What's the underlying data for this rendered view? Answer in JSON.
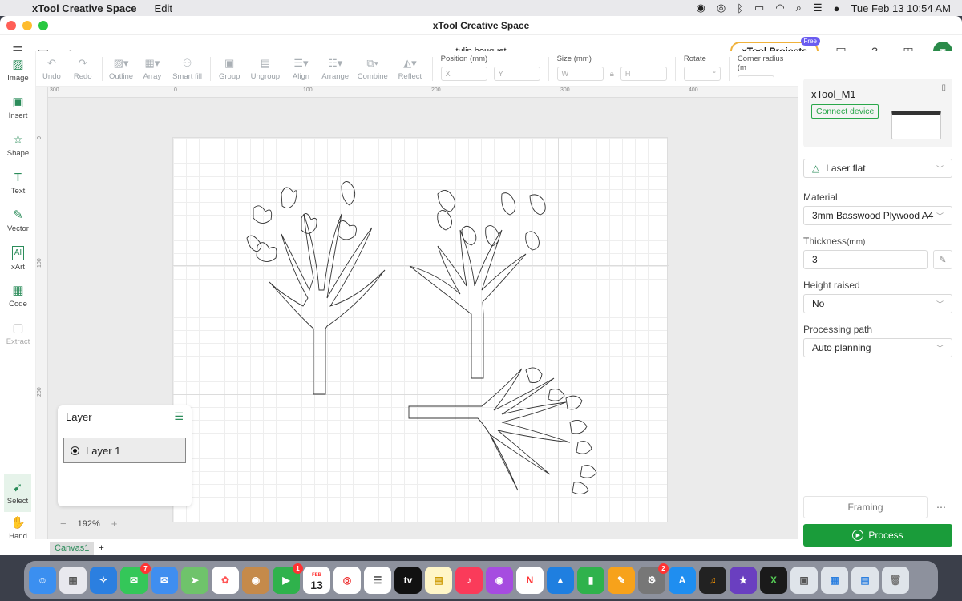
{
  "menubar": {
    "app": "xTool Creative Space",
    "menu": [
      "Edit"
    ],
    "datetime": "Tue Feb 13  10:54 AM"
  },
  "window": {
    "title": "xTool Creative Space"
  },
  "header": {
    "doc_title": "tulip bouquet",
    "projects_label": "xTool Projects",
    "free_badge": "Free"
  },
  "left_tools": [
    {
      "label": "Image",
      "icon": "image-icon"
    },
    {
      "label": "Insert",
      "icon": "insert-icon"
    },
    {
      "label": "Shape",
      "icon": "shape-icon"
    },
    {
      "label": "Text",
      "icon": "text-icon"
    },
    {
      "label": "Vector",
      "icon": "pen-icon"
    },
    {
      "label": "xArt",
      "icon": "ai-icon"
    },
    {
      "label": "Code",
      "icon": "qr-icon"
    },
    {
      "label": "Extract",
      "icon": "extract-icon"
    }
  ],
  "bottom_tools": [
    {
      "label": "Select"
    },
    {
      "label": "Hand"
    }
  ],
  "toolbar": {
    "buttons": [
      "Undo",
      "Redo",
      "Outline",
      "Array",
      "Smart fill",
      "Group",
      "Ungroup",
      "Align",
      "Arrange",
      "Combine",
      "Reflect"
    ],
    "position_label": "Position (mm)",
    "x_ph": "X",
    "y_ph": "Y",
    "size_label": "Size (mm)",
    "w_ph": "W",
    "h_ph": "H",
    "rotate_label": "Rotate",
    "rotate_unit": "°",
    "corner_label": "Corner radius (m"
  },
  "rulers": {
    "top": [
      "300",
      "0",
      "100",
      "200",
      "300",
      "400"
    ],
    "left": [
      "0",
      "100",
      "200"
    ]
  },
  "layer_panel": {
    "title": "Layer",
    "items": [
      "Layer 1"
    ]
  },
  "zoom": {
    "value": "192%",
    "minus": "−",
    "plus": "+"
  },
  "canvas_tabs": {
    "tabs": [
      "Canvas1"
    ],
    "add": "+"
  },
  "right_panel": {
    "device_name": "xTool_M1",
    "connect_label": "Connect device",
    "mode": "Laser flat",
    "material_label": "Material",
    "material_value": "3mm Basswood Plywood A4",
    "thickness_label": "Thickness",
    "thickness_unit": "(mm)",
    "thickness_value": "3",
    "height_label": "Height raised",
    "height_value": "No",
    "path_label": "Processing path",
    "path_value": "Auto planning",
    "framing_label": "Framing",
    "process_label": "Process"
  },
  "dock": {
    "apps": [
      "Finder",
      "Launchpad",
      "Safari",
      "Messages",
      "Mail",
      "Maps",
      "Photos",
      "Contacts",
      "FaceTime",
      "Calendar",
      "Chrome",
      "Reminders",
      "TV",
      "Notes",
      "Music",
      "Podcasts",
      "News",
      "Keynote",
      "Numbers",
      "Pages",
      "System Settings",
      "App Store",
      "GarageBand",
      "iMovie",
      "xTool",
      "Preview",
      "Screenshots",
      "Downloads",
      "Trash"
    ],
    "badges": {
      "Messages": "7",
      "FaceTime": "1",
      "System Settings": "2"
    },
    "calendar_month": "FEB",
    "calendar_day": "13"
  }
}
